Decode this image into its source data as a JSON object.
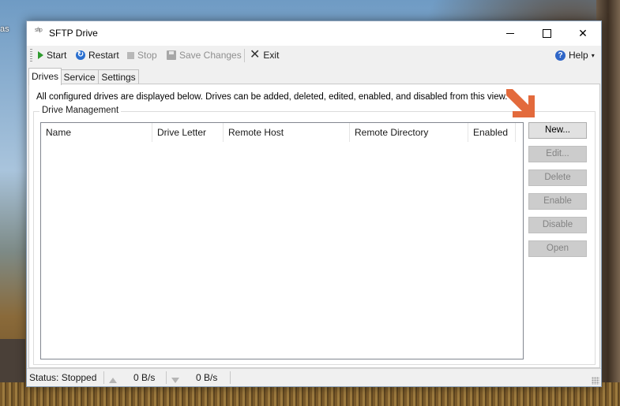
{
  "desktop": {
    "left_text": "as"
  },
  "window": {
    "title": "SFTP Drive",
    "app_icon_text": "sftp",
    "controls": {
      "minimize": "",
      "maximize": "",
      "close": "✕"
    }
  },
  "toolbar": {
    "start": "Start",
    "restart": "Restart",
    "stop": "Stop",
    "save_changes": "Save Changes",
    "exit": "Exit",
    "help": "Help"
  },
  "tabs": [
    {
      "label": "Drives",
      "active": true
    },
    {
      "label": "Service",
      "active": false
    },
    {
      "label": "Settings",
      "active": false
    }
  ],
  "drives_panel": {
    "info": "All configured drives are displayed below. Drives can be added, deleted, edited, enabled, and disabled from this view.",
    "group_label": "Drive Management",
    "columns": [
      "Name",
      "Drive Letter",
      "Remote Host",
      "Remote Directory",
      "Enabled"
    ],
    "rows": [],
    "buttons": [
      {
        "label": "New...",
        "enabled": true
      },
      {
        "label": "Edit...",
        "enabled": false
      },
      {
        "label": "Delete",
        "enabled": false
      },
      {
        "label": "Enable",
        "enabled": false
      },
      {
        "label": "Disable",
        "enabled": false
      },
      {
        "label": "Open",
        "enabled": false
      }
    ]
  },
  "statusbar": {
    "status": "Status: Stopped",
    "upload_rate": "0 B/s",
    "download_rate": "0 B/s"
  },
  "colors": {
    "annotation_arrow": "#e36a3c",
    "start_icon": "#2e9a2e",
    "accent_blue": "#2a6fcf"
  }
}
